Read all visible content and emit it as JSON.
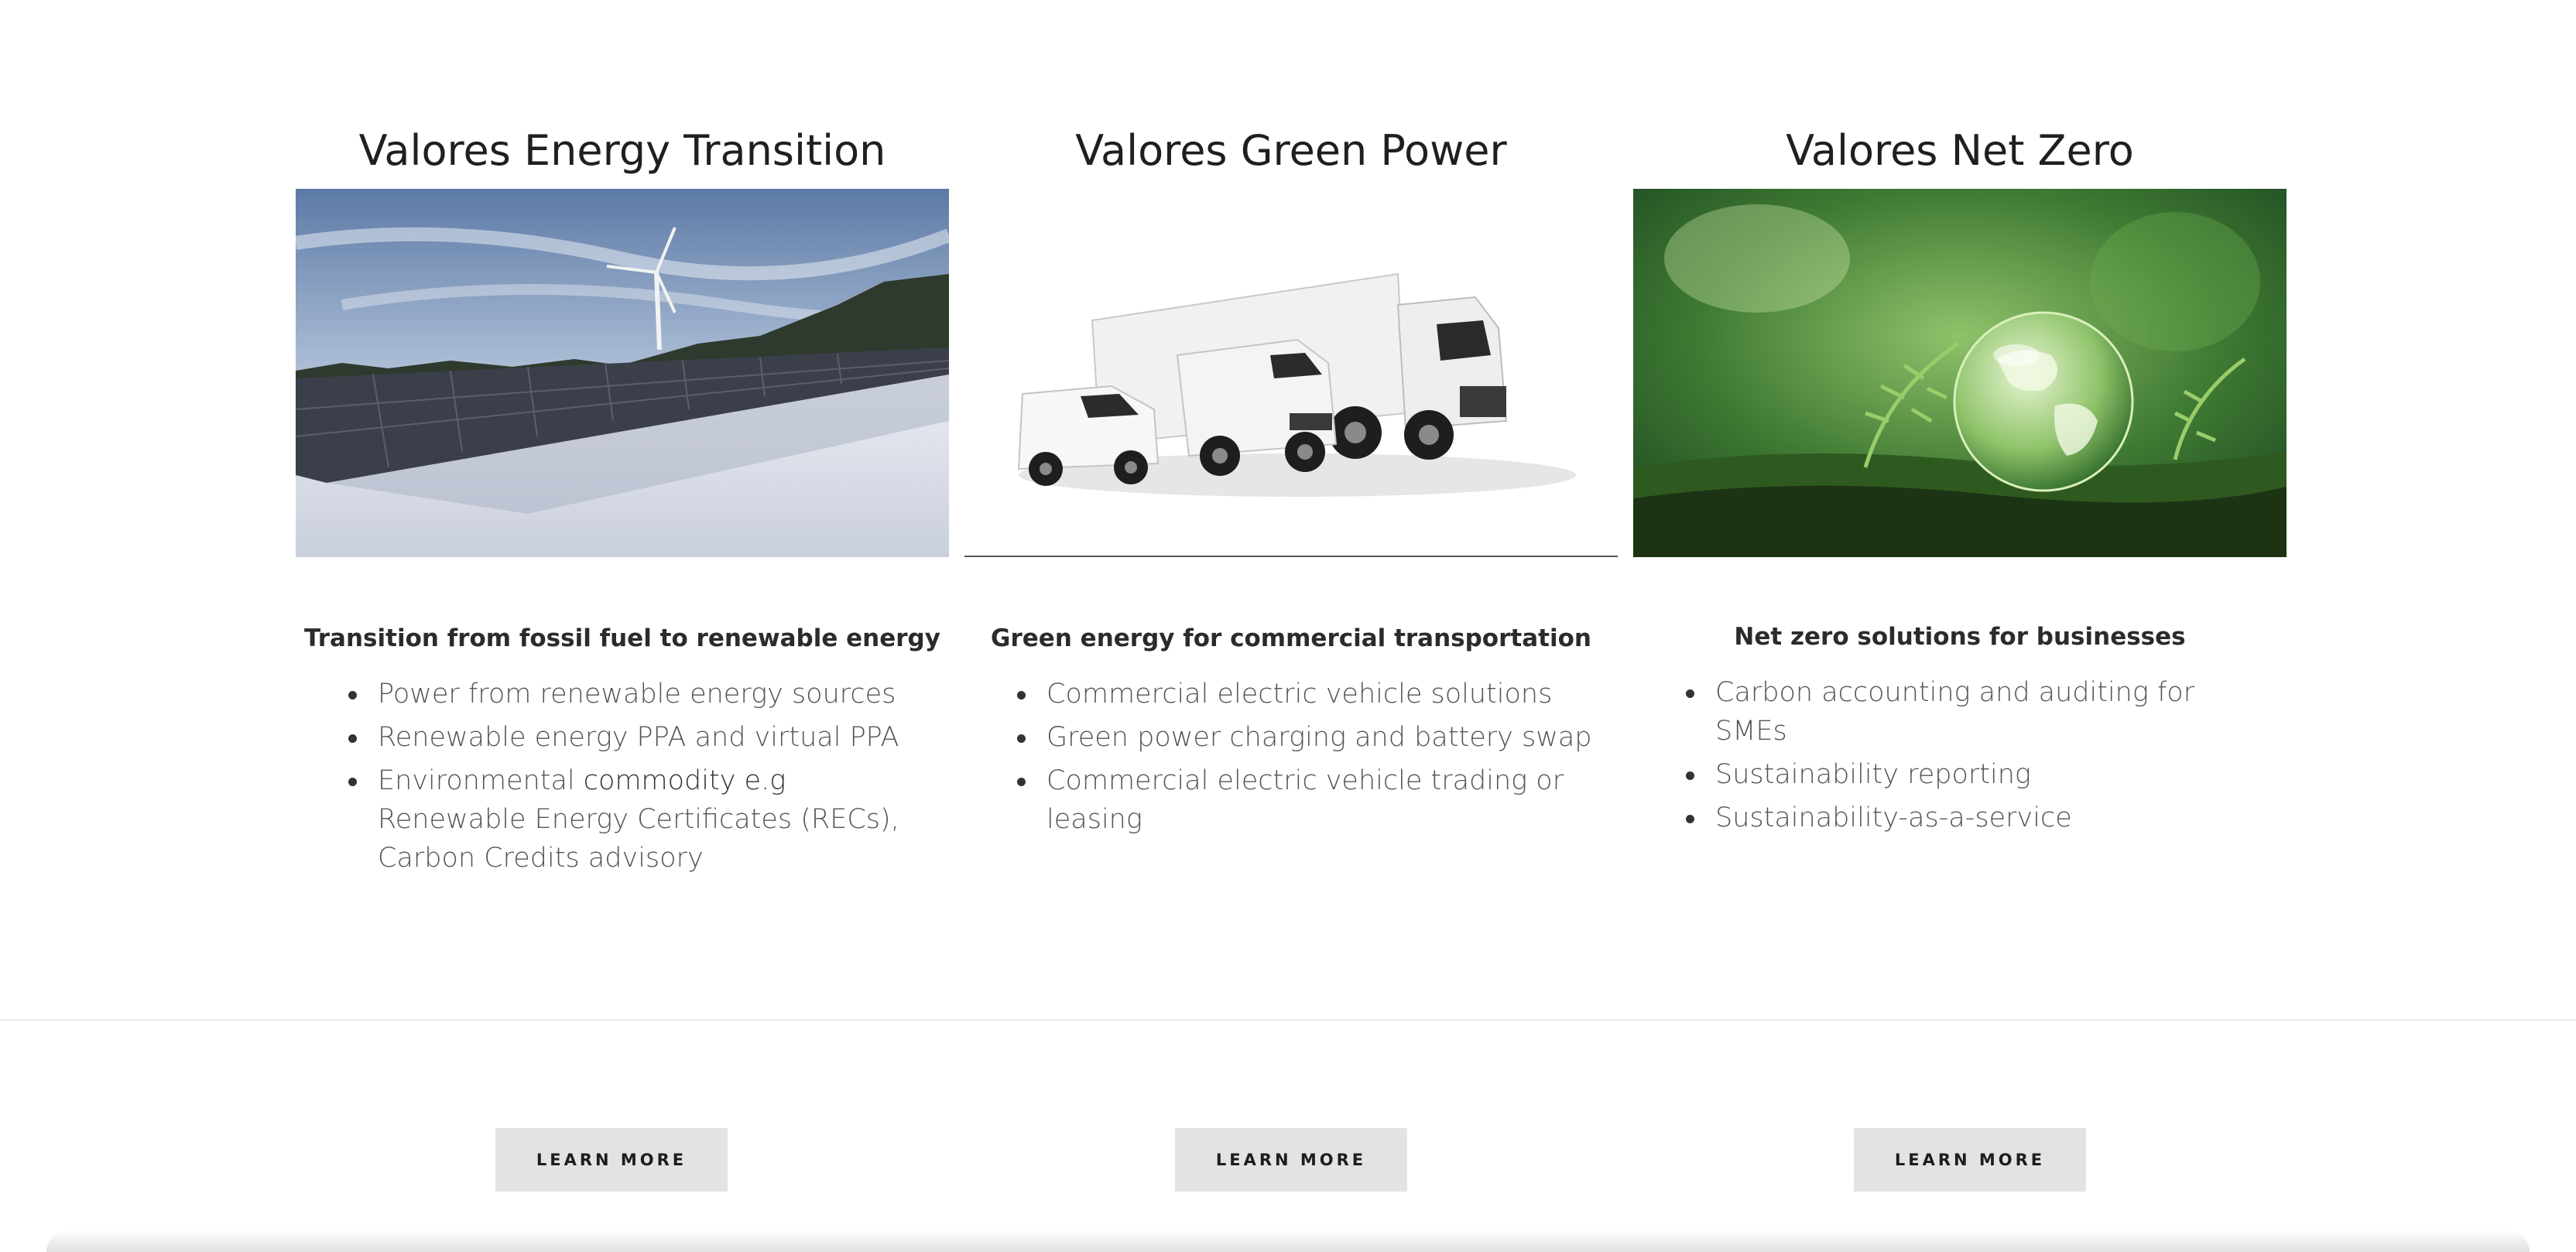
{
  "columns": [
    {
      "title": "Valores Energy Transition",
      "image_subject": "solar panels in snow with wind turbine",
      "subtitle": "Transition from fossil fuel to renewable energy",
      "items": [
        {
          "text": "Power from renewable energy sources"
        },
        {
          "text": "Renewable energy PPA and virtual PPA"
        },
        {
          "text_before": "Environmental ",
          "link_text": "commodity e.g",
          "text_after": " Renewable Energy Certificates (RECs), Carbon Credits advisory"
        }
      ],
      "button_label": "LEARN MORE"
    },
    {
      "title": "Valores Green Power",
      "image_subject": "white commercial vehicles: small van, large van, truck",
      "subtitle": "Green energy for commercial transportation",
      "items": [
        {
          "text": "Commercial electric vehicle solutions"
        },
        {
          "text": "Green power charging and battery swap"
        },
        {
          "text": "Commercial electric vehicle trading or leasing"
        }
      ],
      "button_label": "LEARN MORE"
    },
    {
      "title": "Valores Net Zero",
      "image_subject": "glass globe on moss with ferns",
      "subtitle": "Net zero solutions for businesses",
      "items": [
        {
          "text": "Carbon accounting and auditing for SMEs"
        },
        {
          "text": "Sustainability reporting"
        },
        {
          "text": "Sustainability-as-a-service"
        }
      ],
      "button_label": "LEARN MORE"
    }
  ],
  "colors": {
    "button_bg": "#e2e3e5",
    "title": "#1f1f1f",
    "list_text": "#555555"
  }
}
